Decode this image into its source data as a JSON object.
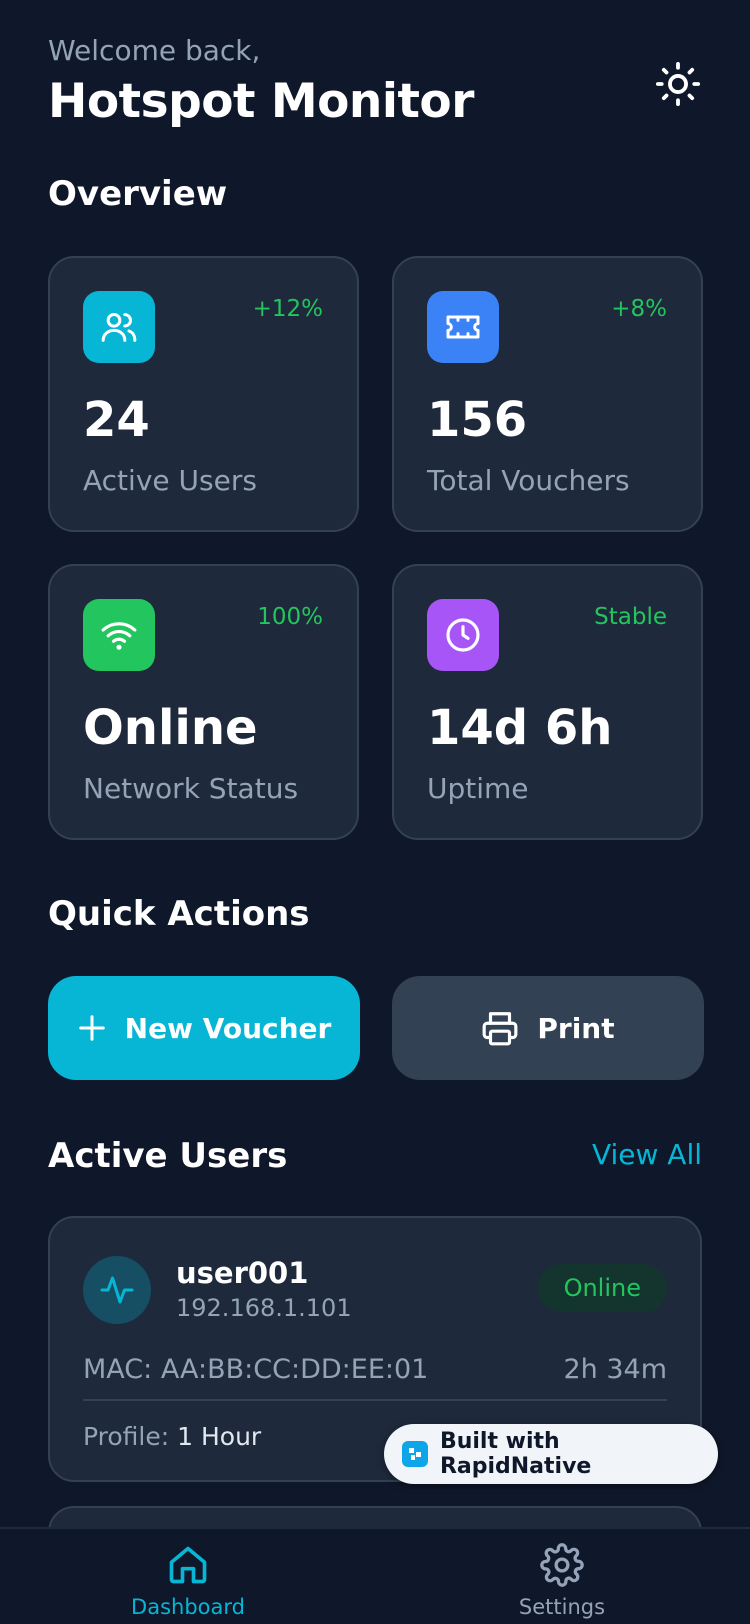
{
  "header": {
    "welcome": "Welcome back,",
    "title": "Hotspot Monitor",
    "theme_icon": "sun-icon"
  },
  "overview": {
    "title": "Overview",
    "cards": [
      {
        "icon": "users-icon",
        "color": "#06b6d4",
        "delta": "+12%",
        "value": "24",
        "label": "Active Users"
      },
      {
        "icon": "ticket-icon",
        "color": "#3b82f6",
        "delta": "+8%",
        "value": "156",
        "label": "Total Vouchers"
      },
      {
        "icon": "wifi-icon",
        "color": "#22c55e",
        "delta": "100%",
        "value": "Online",
        "label": "Network Status"
      },
      {
        "icon": "clock-icon",
        "color": "#a855f7",
        "delta": "Stable",
        "value": "14d 6h",
        "label": "Uptime"
      }
    ]
  },
  "quick_actions": {
    "title": "Quick Actions",
    "new_voucher": "New Voucher",
    "print": "Print"
  },
  "active_users": {
    "title": "Active Users",
    "view_all": "View All",
    "users": [
      {
        "name": "user001",
        "ip": "192.168.1.101",
        "status": "Online",
        "mac": "MAC: AA:BB:CC:DD:EE:01",
        "duration": "2h 34m",
        "profile_label": "Profile:",
        "profile_value": "1 Hour"
      }
    ]
  },
  "badge": {
    "text": "Built with RapidNative"
  },
  "nav": {
    "dashboard": "Dashboard",
    "settings": "Settings"
  },
  "colors": {
    "background": "#0f172a",
    "card": "#1e293b",
    "accent": "#06b6d4",
    "success": "#22c55e"
  }
}
